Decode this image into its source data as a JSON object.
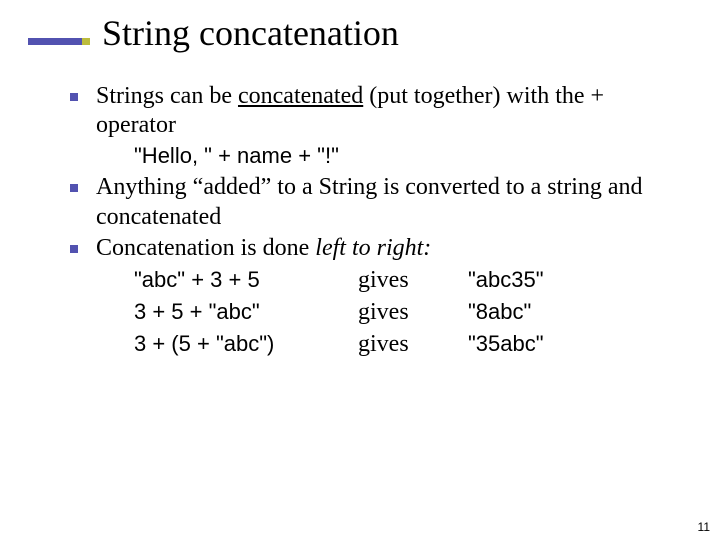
{
  "title": "String concatenation",
  "bullets": [
    {
      "pre": "Strings can be ",
      "underlined": "concatenated",
      "post": " (put together) with the + operator",
      "code_after": "\"Hello, \" + name + \"!\""
    },
    {
      "text": "Anything “added” to a String is converted to a string and concatenated"
    },
    {
      "pre": "Concatenation is done ",
      "italic": "left to right:",
      "examples": [
        {
          "expr": "\"abc\" + 3 + 5",
          "mid": "gives",
          "res": "\"abc35\""
        },
        {
          "expr": "3 + 5 + \"abc\"",
          "mid": "gives",
          "res": "\"8abc\""
        },
        {
          "expr": "3 + (5 + \"abc\")",
          "mid": "gives",
          "res": "\"35abc\""
        }
      ]
    }
  ],
  "page_number": "11"
}
